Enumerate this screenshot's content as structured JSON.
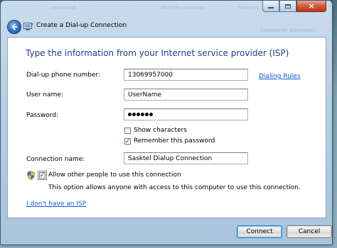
{
  "background": {
    "ghost_left": "... connected",
    "ghost_middle": "Multiple networks",
    "ghost_right": "Internet",
    "ghost_link": "Connect or disconnect"
  },
  "window": {
    "title": "Create a Dial-up Connection",
    "back_button_label": "Back"
  },
  "form": {
    "heading": "Type the information from your Internet service provider (ISP)",
    "phone_label": "Dial-up phone number:",
    "phone_value": "13069957000",
    "dialing_rules_link": "Dialing Rules",
    "username_label": "User name:",
    "username_value": "UserName",
    "password_label": "Password:",
    "password_length": 6,
    "show_characters_label": "Show characters",
    "show_characters_checked": false,
    "remember_password_label": "Remember this password",
    "remember_password_checked": true,
    "connection_name_label": "Connection name:",
    "connection_name_value": "Sasktel Dialup Connection",
    "allow_others_label": "Allow other people to use this connection",
    "allow_others_checked": true,
    "allow_others_description": "This option allows anyone with access to this computer to use this connection.",
    "no_isp_link": "I don't have an ISP"
  },
  "buttons": {
    "connect": "Connect",
    "cancel": "Cancel"
  },
  "icons": {
    "back": "back-arrow-icon",
    "window": "dialup-connection-icon",
    "shield": "uac-shield-icon"
  },
  "colors": {
    "heading": "#1e3d8f",
    "link": "#1a56c4",
    "close_button": "#c8452b"
  }
}
